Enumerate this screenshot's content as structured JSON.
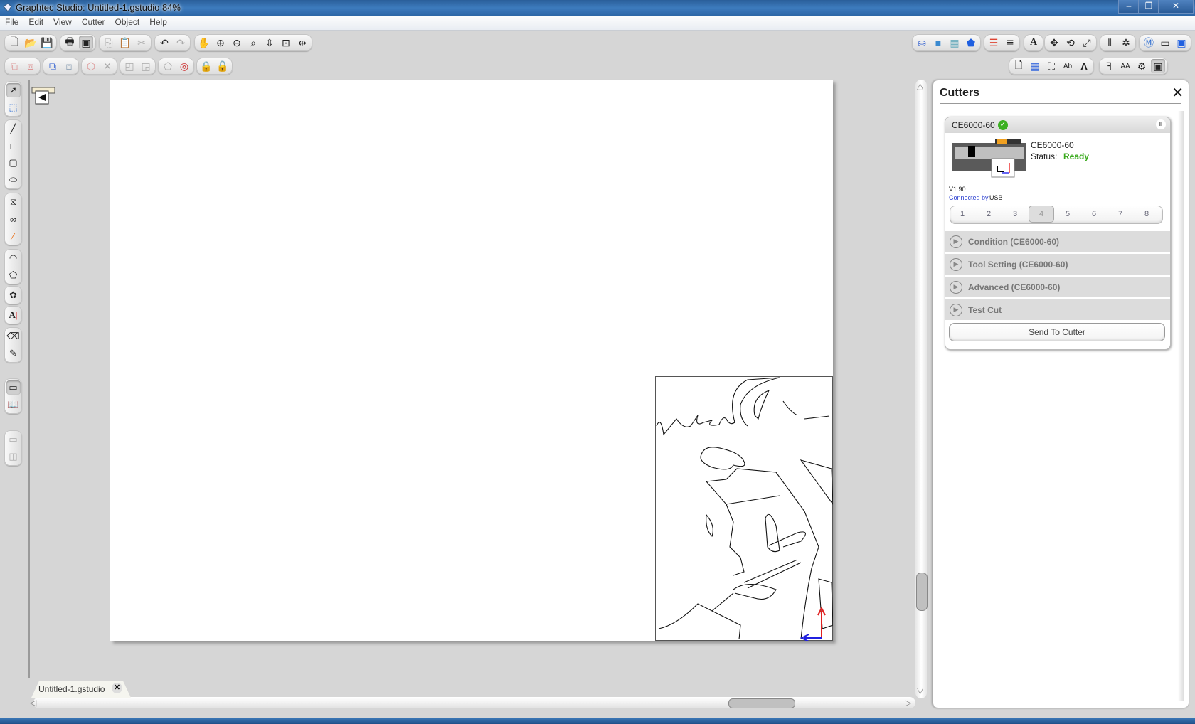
{
  "window": {
    "title": "Graphtec Studio: Untitled-1.gstudio 84%",
    "controls": {
      "minimize": "–",
      "restore": "❐",
      "close": "✕"
    }
  },
  "menu": [
    "File",
    "Edit",
    "View",
    "Cutter",
    "Object",
    "Help"
  ],
  "toolbar_top_left": [
    [
      "new-document",
      "open-file",
      "save"
    ],
    [
      "print",
      "send-to-cutter-window"
    ],
    [
      "copy",
      "paste",
      "cut"
    ],
    [
      "undo",
      "redo"
    ],
    [
      "pan-hand",
      "zoom-in",
      "zoom-out",
      "zoom-selection",
      "zoom-drag",
      "fit-to-window",
      "fit-width"
    ]
  ],
  "toolbar_second_left": [
    [
      "group",
      "ungroup"
    ],
    [
      "make-compound",
      "release-compound"
    ],
    [
      "offset",
      "delete-x"
    ],
    [
      "bring-front",
      "send-back"
    ],
    [
      "weld",
      "registration-mark"
    ],
    [
      "lock",
      "unlock"
    ]
  ],
  "toolbar_top_right": [
    [
      "fill-bucket",
      "line-color",
      "fill-pattern",
      "shape-fill"
    ],
    [
      "line-style",
      "line-weight"
    ],
    [
      "text-style"
    ],
    [
      "move",
      "rotate",
      "scale"
    ],
    [
      "align",
      "replicate"
    ],
    [
      "media-settings",
      "page-setup",
      "cut-area"
    ]
  ],
  "toolbar_second_right": [
    [
      "page-layout",
      "grid",
      "crop",
      "text-format",
      "mirror"
    ],
    [
      "trace",
      "font-size",
      "cutter-settings",
      "send-panel"
    ]
  ],
  "left_tools": {
    "select": [
      "select-arrow",
      "edit-points"
    ],
    "draw": [
      "line",
      "rectangle",
      "rounded-rectangle",
      "ellipse"
    ],
    "curves": [
      "polygon-pen",
      "bezier",
      "freehand"
    ],
    "shapes": [
      "arc",
      "polygon"
    ],
    "star": [
      "flower-shape"
    ],
    "text": [
      "text-tool"
    ],
    "erase": [
      "eraser",
      "knife"
    ],
    "view": [
      "page-view",
      "library"
    ],
    "panels": [
      "single-panel",
      "split-panel"
    ]
  },
  "document_tab": {
    "label": "Untitled-1.gstudio",
    "close": "✕"
  },
  "cutters_panel": {
    "title": "Cutters",
    "close": "✕",
    "device": {
      "name": "CE6000-60",
      "model": "CE6000-60",
      "status_label": "Status:",
      "status_value": "Ready",
      "firmware": "V1.90",
      "connected_label": "Connected by:",
      "connected_value": "USB",
      "pause": "II"
    },
    "slots": [
      "1",
      "2",
      "3",
      "4",
      "5",
      "6",
      "7",
      "8"
    ],
    "selected_slot": "4",
    "sections": [
      "Condition (CE6000-60)",
      "Tool Setting (CE6000-60)",
      "Advanced (CE6000-60)",
      "Test Cut"
    ],
    "send_button": "Send To Cutter"
  },
  "colors": {
    "status_ready": "#3aaa1e",
    "connected_label": "#2a3fd0",
    "axis_y": "#e02020",
    "axis_x": "#2020e0"
  }
}
